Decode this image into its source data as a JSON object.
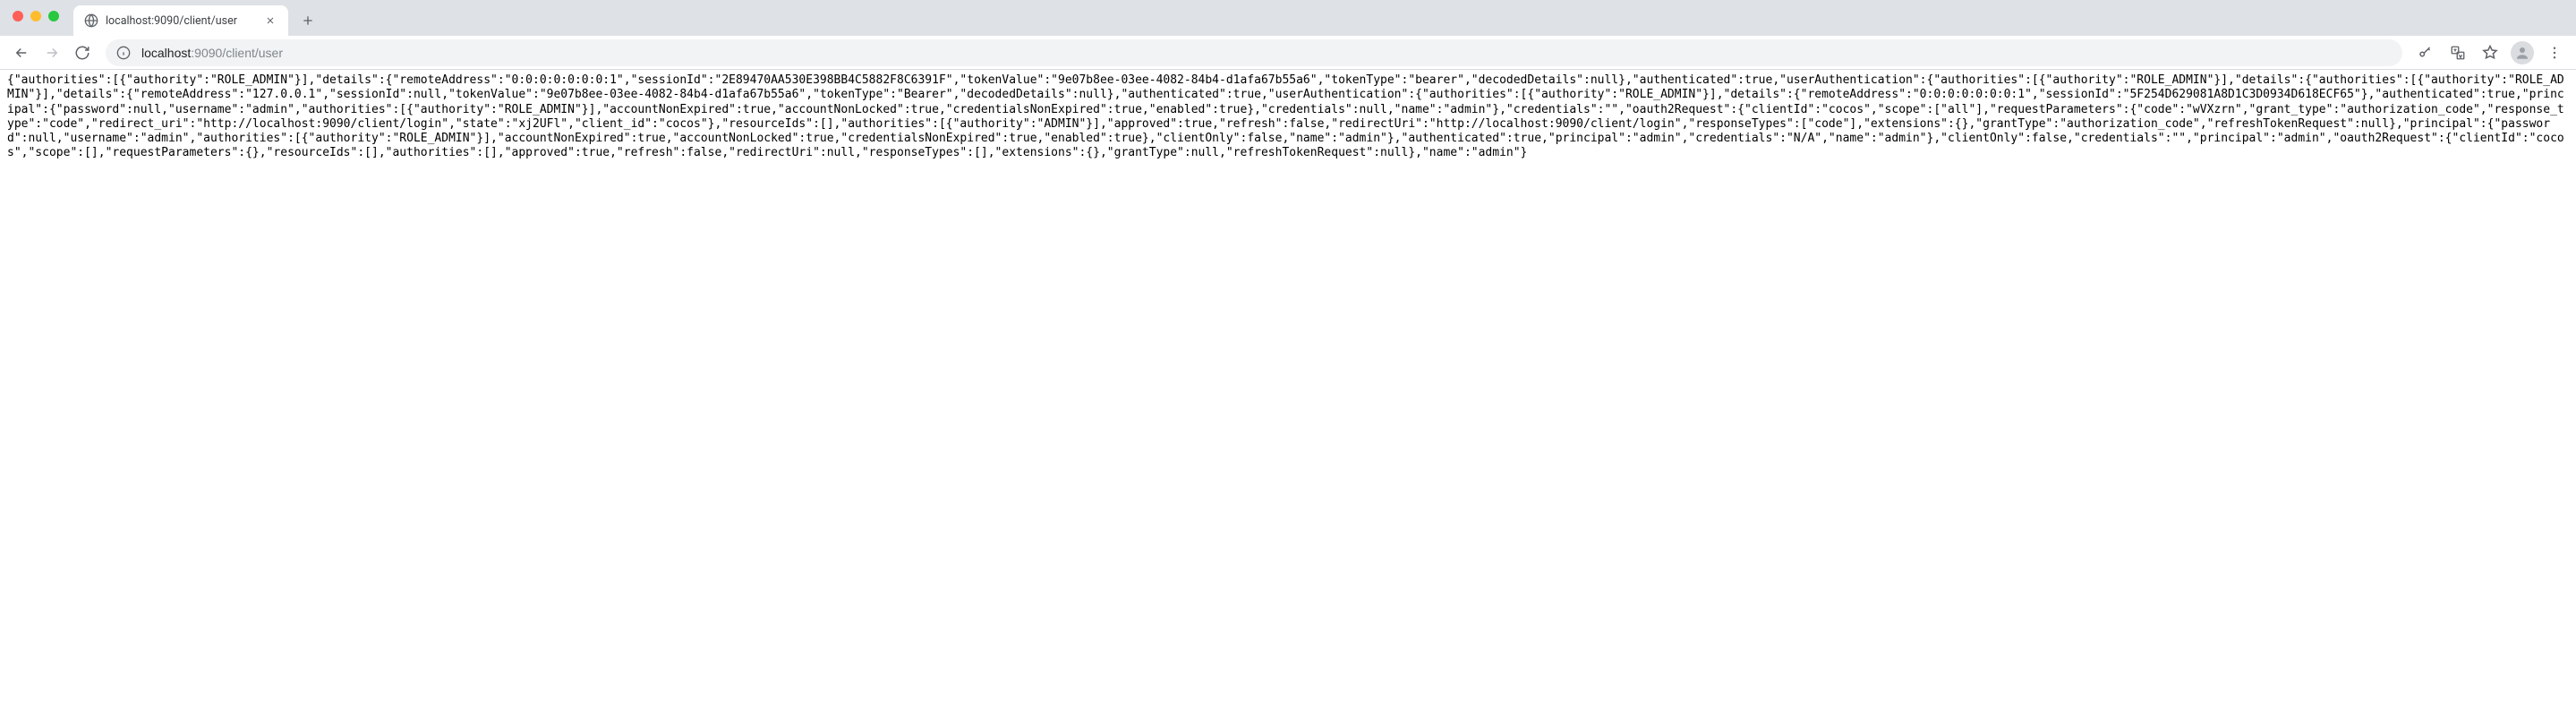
{
  "tab": {
    "title": "localhost:9090/client/user"
  },
  "url": {
    "host": "localhost",
    "port": ":9090",
    "path": "/client/user"
  },
  "response_body": "{\"authorities\":[{\"authority\":\"ROLE_ADMIN\"}],\"details\":{\"remoteAddress\":\"0:0:0:0:0:0:0:1\",\"sessionId\":\"2E89470AA530E398BB4C5882F8C6391F\",\"tokenValue\":\"9e07b8ee-03ee-4082-84b4-d1afa67b55a6\",\"tokenType\":\"bearer\",\"decodedDetails\":null},\"authenticated\":true,\"userAuthentication\":{\"authorities\":[{\"authority\":\"ROLE_ADMIN\"}],\"details\":{\"authorities\":[{\"authority\":\"ROLE_ADMIN\"}],\"details\":{\"remoteAddress\":\"127.0.0.1\",\"sessionId\":null,\"tokenValue\":\"9e07b8ee-03ee-4082-84b4-d1afa67b55a6\",\"tokenType\":\"Bearer\",\"decodedDetails\":null},\"authenticated\":true,\"userAuthentication\":{\"authorities\":[{\"authority\":\"ROLE_ADMIN\"}],\"details\":{\"remoteAddress\":\"0:0:0:0:0:0:0:1\",\"sessionId\":\"5F254D629081A8D1C3D0934D618ECF65\"},\"authenticated\":true,\"principal\":{\"password\":null,\"username\":\"admin\",\"authorities\":[{\"authority\":\"ROLE_ADMIN\"}],\"accountNonExpired\":true,\"accountNonLocked\":true,\"credentialsNonExpired\":true,\"enabled\":true},\"credentials\":null,\"name\":\"admin\"},\"credentials\":\"\",\"oauth2Request\":{\"clientId\":\"cocos\",\"scope\":[\"all\"],\"requestParameters\":{\"code\":\"wVXzrn\",\"grant_type\":\"authorization_code\",\"response_type\":\"code\",\"redirect_uri\":\"http://localhost:9090/client/login\",\"state\":\"xj2UFl\",\"client_id\":\"cocos\"},\"resourceIds\":[],\"authorities\":[{\"authority\":\"ADMIN\"}],\"approved\":true,\"refresh\":false,\"redirectUri\":\"http://localhost:9090/client/login\",\"responseTypes\":[\"code\"],\"extensions\":{},\"grantType\":\"authorization_code\",\"refreshTokenRequest\":null},\"principal\":{\"password\":null,\"username\":\"admin\",\"authorities\":[{\"authority\":\"ROLE_ADMIN\"}],\"accountNonExpired\":true,\"accountNonLocked\":true,\"credentialsNonExpired\":true,\"enabled\":true},\"clientOnly\":false,\"name\":\"admin\"},\"authenticated\":true,\"principal\":\"admin\",\"credentials\":\"N/A\",\"name\":\"admin\"},\"clientOnly\":false,\"credentials\":\"\",\"principal\":\"admin\",\"oauth2Request\":{\"clientId\":\"cocos\",\"scope\":[],\"requestParameters\":{},\"resourceIds\":[],\"authorities\":[],\"approved\":true,\"refresh\":false,\"redirectUri\":null,\"responseTypes\":[],\"extensions\":{},\"grantType\":null,\"refreshTokenRequest\":null},\"name\":\"admin\"}"
}
